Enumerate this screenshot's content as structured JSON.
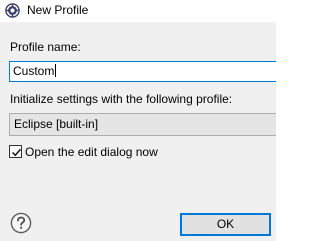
{
  "window": {
    "title": "New Profile",
    "icon": "eclipse-settings-icon"
  },
  "form": {
    "profile_name_label": "Profile name:",
    "profile_name_value": "Custom",
    "init_label": "Initialize settings with the following profile:",
    "init_profile_selected": "Eclipse [built-in]",
    "open_dialog_label": "Open the edit dialog now",
    "open_dialog_checked": true
  },
  "buttons": {
    "help_icon": "question-mark-icon",
    "ok_label": "OK"
  },
  "colors": {
    "accent": "#0078d7",
    "dialog_background": "#f0f0f0",
    "titlebar_background": "#ffffff",
    "select_background": "#e5e5e5",
    "button_background": "#e1e1e1"
  }
}
